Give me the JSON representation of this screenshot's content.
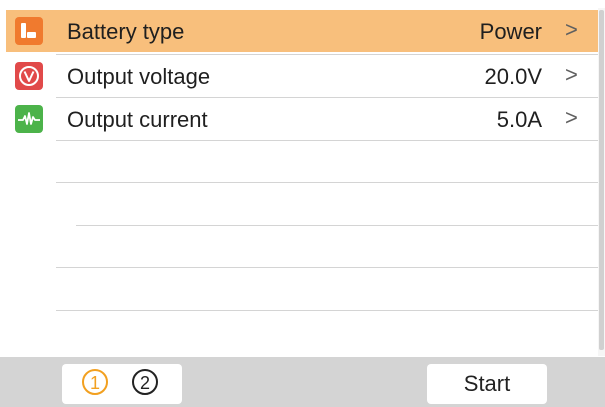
{
  "rows": [
    {
      "label": "Battery type",
      "value": "Power",
      "icon": "battery-icon",
      "selected": true
    },
    {
      "label": "Output voltage",
      "value": "20.0V",
      "icon": "voltage-icon",
      "selected": false
    },
    {
      "label": "Output current",
      "value": "5.0A",
      "icon": "current-icon",
      "selected": false
    }
  ],
  "chevron": ">",
  "footer": {
    "pages": [
      "1",
      "2"
    ],
    "active_page": "1",
    "start_label": "Start"
  },
  "colors": {
    "selected_row": "#f8bf7c",
    "battery_icon": "#f07a2e",
    "voltage_icon": "#e14a4a",
    "current_icon": "#4cb34a",
    "active_page": "#f2a020",
    "footer_bg": "#d4d4d4"
  }
}
